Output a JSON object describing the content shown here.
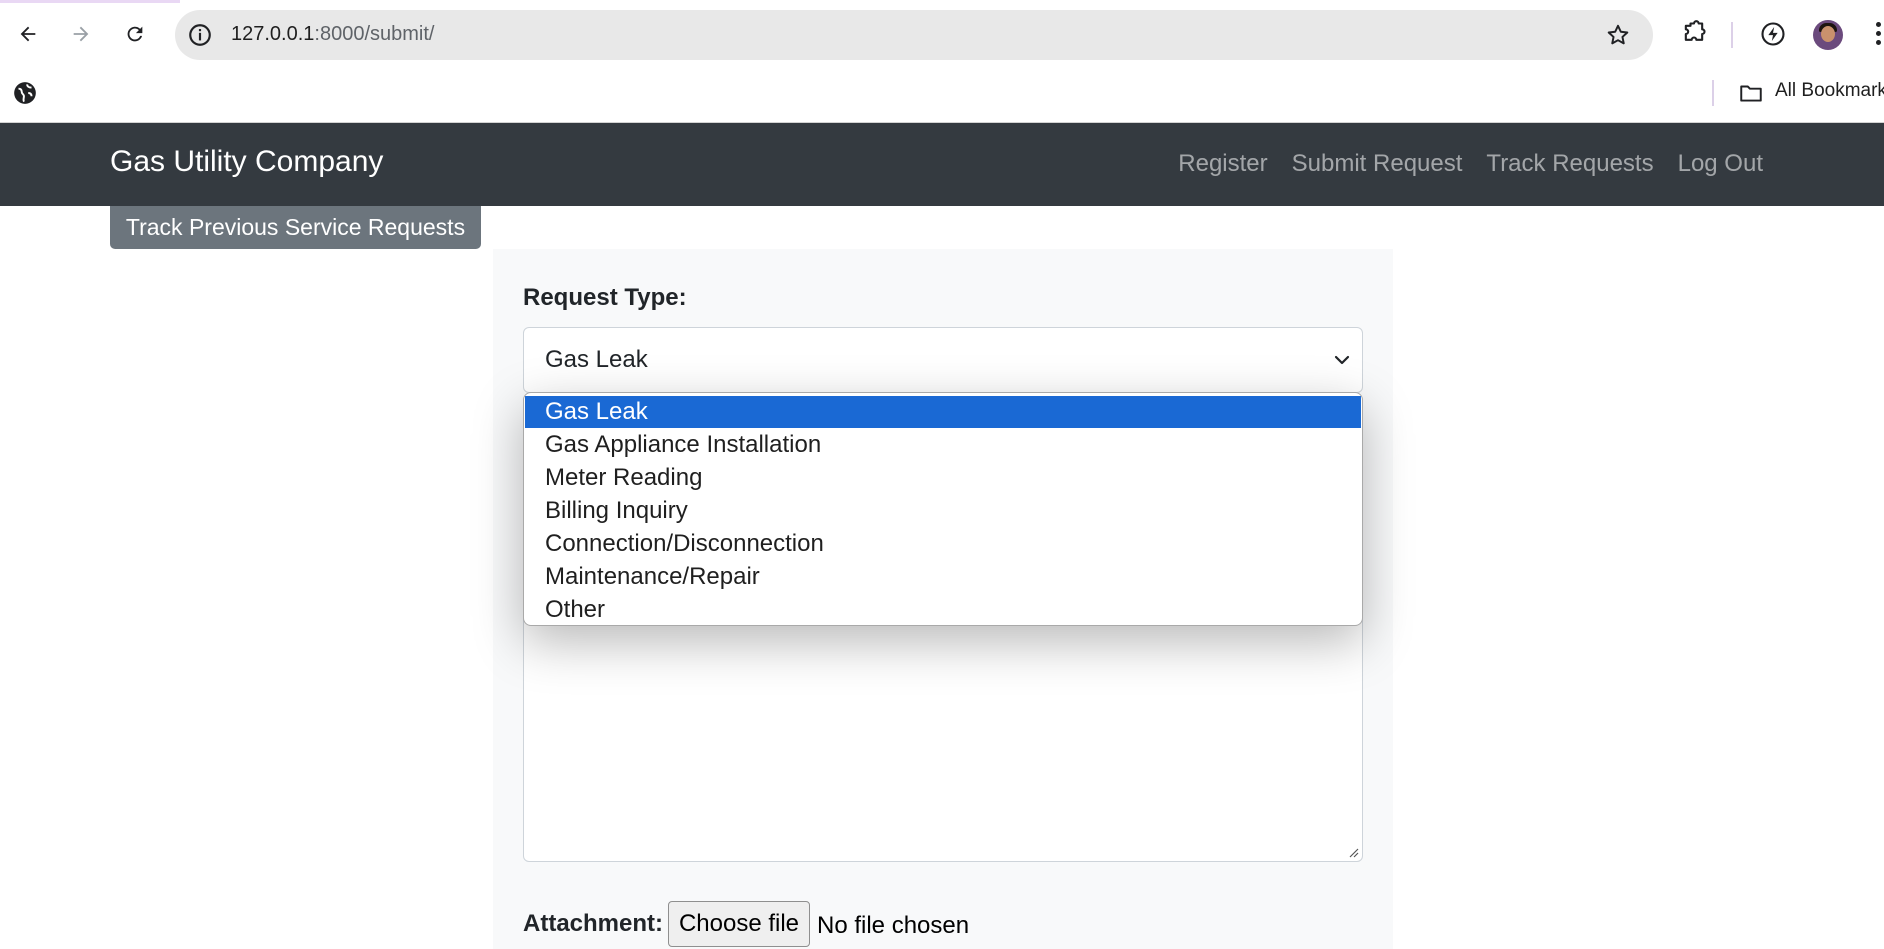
{
  "browser": {
    "url_host": "127.0.0.1",
    "url_rest": ":8000/submit/",
    "bookmarks_label": "All Bookmarks"
  },
  "navbar": {
    "brand": "Gas Utility Company",
    "links": [
      "Register",
      "Submit Request",
      "Track Requests",
      "Log Out"
    ]
  },
  "track_button_label": "Track Previous Service Requests",
  "form": {
    "request_type_label": "Request Type:",
    "request_type_value": "Gas Leak",
    "request_type_options": [
      "Gas Leak",
      "Gas Appliance Installation",
      "Meter Reading",
      "Billing Inquiry",
      "Connection/Disconnection",
      "Maintenance/Repair",
      "Other"
    ],
    "attachment_label": "Attachment:",
    "choose_file_label": "Choose file",
    "file_status": "No file chosen"
  },
  "colors": {
    "navbar_bg": "#343a40",
    "selected_option": "#1a69d4",
    "track_button_bg": "#6c757d"
  }
}
